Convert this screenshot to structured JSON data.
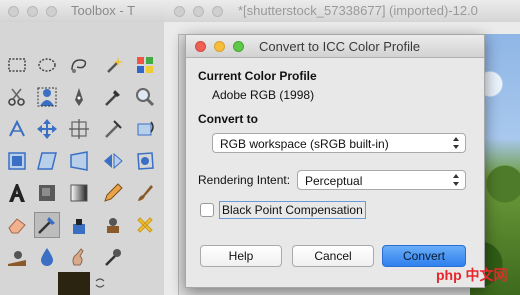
{
  "toolbox": {
    "title": "Toolbox - T",
    "tools": [
      "rect-select-icon",
      "ellipse-select-icon",
      "free-select-icon",
      "fuzzy-select-icon",
      "color-select-icon",
      "scissors-select-icon",
      "foreground-select-icon",
      "paths-icon",
      "color-picker-icon",
      "magnify-icon",
      "measure-icon",
      "move-icon",
      "align-icon",
      "crop-icon",
      "rotate-icon",
      "scale-icon",
      "shear-icon",
      "perspective-icon",
      "flip-icon",
      "cage-icon",
      "text-icon",
      "bucket-fill-icon",
      "gradient-icon",
      "pencil-icon",
      "paintbrush-icon",
      "eraser-icon",
      "airbrush-icon",
      "ink-icon",
      "clone-icon",
      "heal-icon",
      "perspective-clone-icon",
      "blur-icon",
      "smudge-icon",
      "dodge-burn-icon"
    ]
  },
  "image_window": {
    "title": "*[shutterstock_57338677] (imported)-12.0"
  },
  "dialog": {
    "title": "Convert to ICC Color Profile",
    "current_profile_heading": "Current Color Profile",
    "current_profile_value": "Adobe RGB (1998)",
    "convert_to_heading": "Convert to",
    "convert_to_value": "RGB workspace (sRGB built-in)",
    "intent_label": "Rendering Intent:",
    "intent_value": "Perceptual",
    "bpc_label": "Black Point Compensation",
    "bpc_checked": false,
    "help_label": "Help",
    "cancel_label": "Cancel",
    "convert_label": "Convert"
  },
  "watermark": "php 中文网"
}
